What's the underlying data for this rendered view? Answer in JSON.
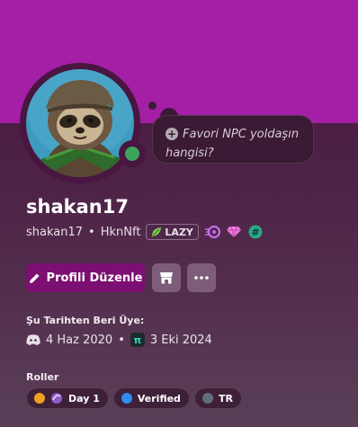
{
  "profile": {
    "display_name": "shakan17",
    "username": "shakan17",
    "separator": "•",
    "pronoun_or_nick": "HknNft",
    "clan_tag": "LAZY",
    "status_color": "#3ba55c",
    "banner_color": "#a51ea6"
  },
  "bubble": {
    "text": "Favori NPC yoldaşın hangisi?"
  },
  "actions": {
    "edit_label": "Profili Düzenle"
  },
  "member_since": {
    "heading": "Şu Tarihten Beri Üye:",
    "discord_date": "4 Haz 2020",
    "separator": "•",
    "server_date": "3 Eki 2024",
    "server_icon_text": "π"
  },
  "roles": {
    "heading": "Roller",
    "items": [
      {
        "label": "Day 1",
        "color": "#f0a020"
      },
      {
        "label": "Verified",
        "color": "#2f8cf0"
      },
      {
        "label": "TR",
        "color": "#5f6e78"
      }
    ]
  },
  "icons": {
    "edit": "pencil-icon",
    "shop": "shop-icon",
    "more": "more-dots-icon",
    "plus": "plus-icon",
    "discord": "discord-icon",
    "server": "server-icon"
  }
}
